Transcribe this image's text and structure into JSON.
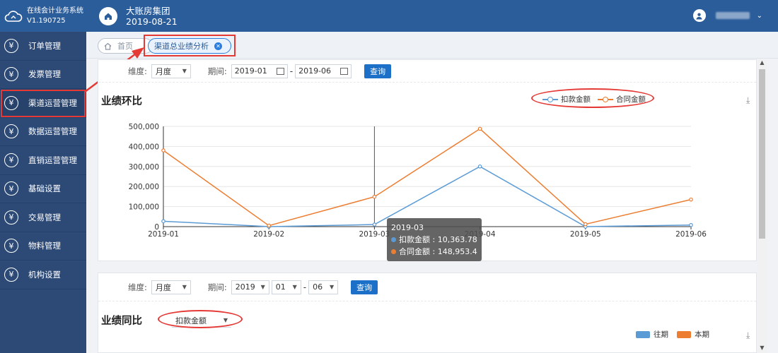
{
  "app": {
    "title_line1": "在线会计业务系统",
    "title_line2": "V1.190725",
    "logo_icon": "cloud-icon"
  },
  "sidebar": {
    "items": [
      {
        "label": "订单管理",
        "icon": "yen-icon"
      },
      {
        "label": "发票管理",
        "icon": "yen-icon"
      },
      {
        "label": "渠道运营管理",
        "icon": "yen-icon",
        "active": true
      },
      {
        "label": "数据运营管理",
        "icon": "yen-icon"
      },
      {
        "label": "直销运营管理",
        "icon": "yen-icon"
      },
      {
        "label": "基础设置",
        "icon": "yen-icon"
      },
      {
        "label": "交易管理",
        "icon": "yen-icon"
      },
      {
        "label": "物料管理",
        "icon": "yen-icon"
      },
      {
        "label": "机构设置",
        "icon": "yen-icon"
      }
    ],
    "yen_glyph": "¥"
  },
  "header": {
    "company": "大账房集团",
    "date": "2019-08-21",
    "home_icon": "home-icon",
    "user_icon": "user-icon",
    "user_caret": "⌄"
  },
  "tabs": {
    "home_label": "首页",
    "active_label": "渠道总业绩分析",
    "close_glyph": "✕"
  },
  "panel1": {
    "dimension_label": "维度:",
    "dimension_value": "月度",
    "period_label": "期间:",
    "date_from": "2019-01",
    "date_to": "2019-06",
    "date_sep": "-",
    "query_label": "查询",
    "title": "业绩环比",
    "download_glyph": "⤓"
  },
  "tooltip": {
    "header": "2019-03",
    "rows": [
      {
        "name": "扣款金额",
        "value": "10,363.78"
      },
      {
        "name": "合同金额",
        "value": "148,953.4"
      }
    ],
    "separator": " : "
  },
  "panel2": {
    "dimension_label": "维度:",
    "dimension_value": "月度",
    "period_label": "期间:",
    "year_value": "2019",
    "month_from": "01",
    "month_to": "06",
    "date_sep": "-",
    "query_label": "查询",
    "title": "业绩同比",
    "metric_select": "扣款金额",
    "legend": [
      {
        "name": "往期",
        "color": "#5b9bd5"
      },
      {
        "name": "本期",
        "color": "#ed7d31"
      }
    ],
    "download_glyph": "⤓"
  },
  "colors": {
    "deduction": "#5b9bd5",
    "contract": "#ed7d31",
    "accent": "#1d70c8",
    "highlight": "#e53935"
  },
  "chart_data": {
    "type": "line",
    "title": "业绩环比",
    "categories": [
      "2019-01",
      "2019-02",
      "2019-03",
      "2019-04",
      "2019-05",
      "2019-06"
    ],
    "series": [
      {
        "name": "扣款金额",
        "values": [
          27000,
          0,
          10363.78,
          300000,
          0,
          8000
        ]
      },
      {
        "name": "合同金额",
        "values": [
          380000,
          5000,
          148953.4,
          488000,
          12000,
          135000
        ]
      }
    ],
    "yticks": [
      "0",
      "100,000",
      "200,000",
      "300,000",
      "400,000",
      "500,000"
    ],
    "ylim": [
      0,
      500000
    ],
    "grid": true,
    "legend_position": "top-right",
    "hover_category": "2019-03"
  }
}
